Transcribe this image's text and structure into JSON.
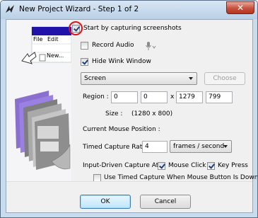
{
  "window": {
    "title": "New Project Wizard - Step 1 of 2",
    "close_glyph": "✕",
    "accent": "#c7503c"
  },
  "art": {
    "menu_file": "File",
    "menu_edit": "Edit",
    "new_item": "New..."
  },
  "options": {
    "start_capture": {
      "label": "Start by capturing screenshots",
      "checked": true
    },
    "record_audio": {
      "label": "Record Audio",
      "checked": false
    },
    "hide_wink": {
      "label": "Hide Wink Window",
      "checked": true
    }
  },
  "capture_area": {
    "selected": "Screen",
    "choose_label": "Choose"
  },
  "region": {
    "label": "Region :",
    "x": "0",
    "y": "0",
    "sep": "x",
    "width": "1279",
    "height": "799",
    "size_label": "Size :",
    "size_value": "(1280 x 800)"
  },
  "mouse_position": {
    "label": "Current Mouse Position :"
  },
  "timed_capture": {
    "label": "Timed Capture Rate",
    "value": "4",
    "unit": "frames / second"
  },
  "input_driven": {
    "label": "Input-Driven Capture At",
    "mouse_click": {
      "label": "Mouse Click",
      "checked": true
    },
    "key_press": {
      "label": "Key Press",
      "checked": true
    },
    "use_timed": {
      "label": "Use Timed Capture When Mouse Button Is Down",
      "checked": false
    }
  },
  "footer": {
    "ok": "OK",
    "cancel": "Cancel"
  },
  "icons": {
    "app": "wink-app-icon",
    "mic": "microphone-icon",
    "dropdown": "chevron-down-icon",
    "highlight": "red-circle-highlight"
  }
}
